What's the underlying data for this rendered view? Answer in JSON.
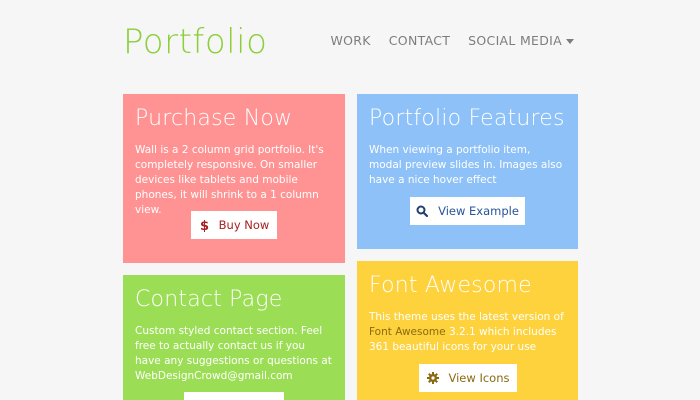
{
  "header": {
    "logo": "Portfolio",
    "nav": [
      {
        "label": "WORK"
      },
      {
        "label": "CONTACT"
      },
      {
        "label": "SOCIAL MEDIA"
      }
    ]
  },
  "cards": {
    "purchase": {
      "title": "Purchase Now",
      "text": "Wall is a 2 column grid portfolio. It's completely responsive. On smaller devices like tablets and mobile phones, it will shrink to a 1 column view.",
      "button_label": "Buy Now",
      "button_icon": "dollar-icon",
      "color": "#ff9393"
    },
    "features": {
      "title": "Portfolio Features",
      "text": "When viewing a portfolio item, modal preview slides in. Images also have a nice hover effect",
      "button_label": "View Example",
      "button_icon": "search-icon",
      "color": "#8ec1f8"
    },
    "contact": {
      "title": "Contact Page",
      "text": "Custom styled contact section. Feel free to actually contact us if you have any suggestions or questions at",
      "email": "WebDesignCrowd@gmail.com",
      "color": "#9bde55"
    },
    "fontawesome": {
      "title": "Font Awesome",
      "text_before": "This theme uses the latest version of",
      "link": "Font Awesome",
      "text_after": "3.2.1 which includes 361 beautiful icons for your use",
      "button_label": "View Icons",
      "button_icon": "gear-icon",
      "color": "#fdd23c"
    }
  }
}
